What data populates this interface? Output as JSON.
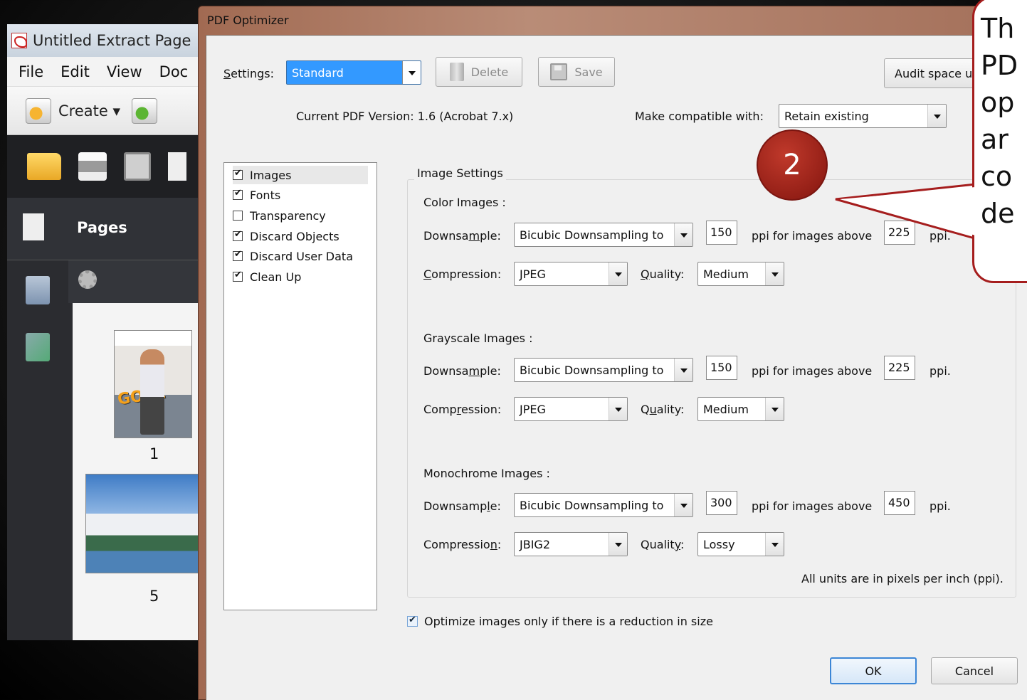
{
  "acrobat": {
    "window_title": "Untitled Extract Page",
    "menu": [
      "File",
      "Edit",
      "View",
      "Doc"
    ],
    "create_label": "Create ▾",
    "pages_panel_title": "Pages",
    "thumbnails": [
      {
        "page_number": "1",
        "cover_text": "GOAL"
      },
      {
        "page_number": "5"
      }
    ]
  },
  "dialog": {
    "title": "PDF Optimizer",
    "settings_label": "Settings:",
    "settings_value": "Standard",
    "delete_label": "Delete",
    "save_label": "Save",
    "audit_label": "Audit space u",
    "current_version": "Current PDF Version: 1.6 (Acrobat 7.x)",
    "compat_label": "Make compatible with:",
    "compat_value": "Retain existing",
    "panels": [
      {
        "label": "Images",
        "checked": true
      },
      {
        "label": "Fonts",
        "checked": true
      },
      {
        "label": "Transparency",
        "checked": false
      },
      {
        "label": "Discard Objects",
        "checked": true
      },
      {
        "label": "Discard User Data",
        "checked": true
      },
      {
        "label": "Clean Up",
        "checked": true
      }
    ],
    "image_settings_title": "Image Settings",
    "sections": [
      {
        "title": "Color Images :",
        "downsample_label": "Downsample:",
        "downsample_value": "Bicubic Downsampling to",
        "ppi": "150",
        "above_text": "ppi for images above",
        "above_ppi": "225",
        "ppi_unit": "ppi.",
        "compression_label": "Compression:",
        "compression_value": "JPEG",
        "quality_label": "Quality:",
        "quality_value": "Medium"
      },
      {
        "title": "Grayscale Images :",
        "downsample_label": "Downsample:",
        "downsample_value": "Bicubic Downsampling to",
        "ppi": "150",
        "above_text": "ppi for images above",
        "above_ppi": "225",
        "ppi_unit": "ppi.",
        "compression_label": "Compression:",
        "compression_value": "JPEG",
        "quality_label": "Quality:",
        "quality_value": "Medium"
      },
      {
        "title": "Monochrome Images :",
        "downsample_label": "Downsample:",
        "downsample_value": "Bicubic Downsampling to",
        "ppi": "300",
        "above_text": "ppi for images above",
        "above_ppi": "450",
        "ppi_unit": "ppi.",
        "compression_label": "Compression:",
        "compression_value": "JBIG2",
        "quality_label": "Quality:",
        "quality_value": "Lossy"
      }
    ],
    "units_note": "All units are in pixels per inch (ppi).",
    "optimize_only_label": "Optimize images only if there is a reduction in size",
    "optimize_only_checked": true,
    "ok_label": "OK",
    "cancel_label": "Cancel"
  },
  "callout": {
    "badge_number": "2",
    "text_lines": [
      "Th",
      "PD",
      "op",
      "ar",
      "co",
      "de"
    ],
    "color": "#a51d1d"
  }
}
